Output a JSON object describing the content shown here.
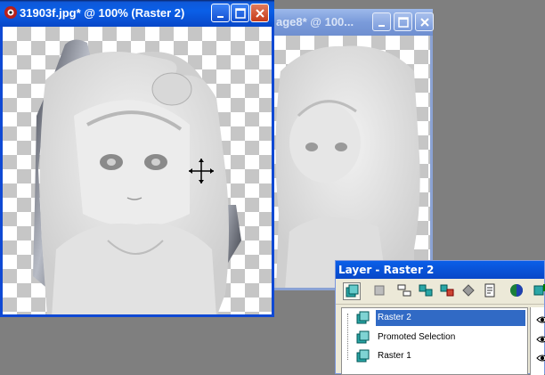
{
  "colors": {
    "active_title": "#0a5fe8",
    "inactive_title": "#7a9bda",
    "selection": "#316ac5",
    "desktop": "#7f7f7f"
  },
  "window_back": {
    "title": "age8* @ 100..."
  },
  "window_front": {
    "title": "31903f.jpg* @ 100% (Raster 2)",
    "icon": "paint-shop-pro-doc-icon"
  },
  "layer_panel": {
    "title": "Layer - Raster 2",
    "toolbar_icons": [
      "new-raster-layer-icon",
      "new-vector-layer-icon",
      "new-layer-group-icon",
      "new-mask-layer-icon",
      "delete-layer-icon",
      "duplicate-layer-icon",
      "properties-icon",
      "adjustment-layer-icon",
      "blend-icon"
    ],
    "layers": [
      {
        "name": "Raster 2",
        "selected": true,
        "visible": true
      },
      {
        "name": "Promoted Selection",
        "selected": false,
        "visible": true
      },
      {
        "name": "Raster 1",
        "selected": false,
        "visible": true
      }
    ]
  }
}
